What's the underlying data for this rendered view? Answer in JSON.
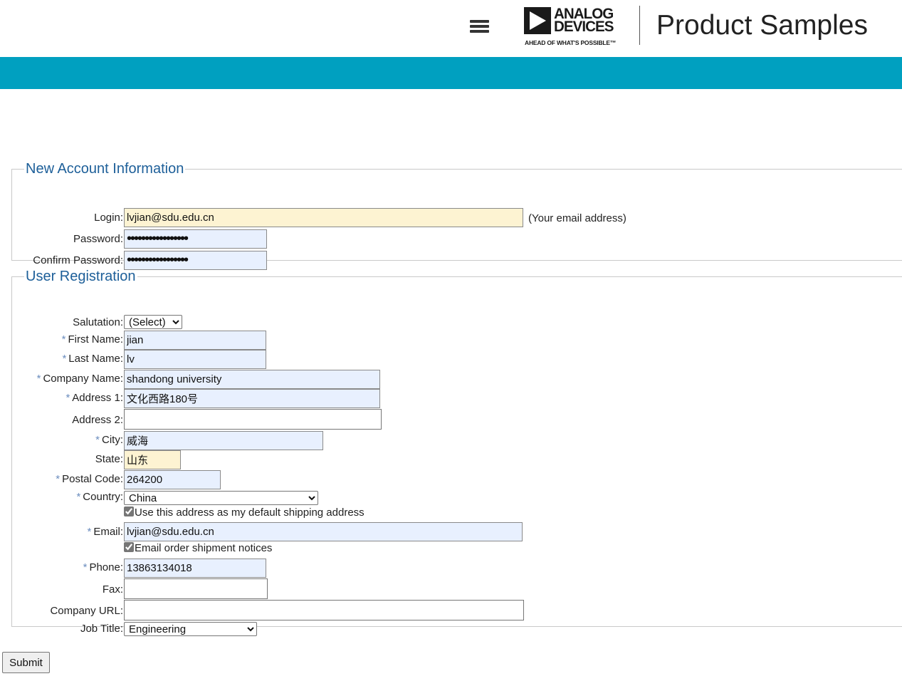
{
  "header": {
    "title": "Product Samples",
    "logo_line1": "ANALOG",
    "logo_line2": "DEVICES",
    "logo_tagline": "AHEAD OF WHAT'S POSSIBLE™"
  },
  "colors": {
    "accent_bar": "#00a0c0",
    "legend_text": "#1d5f99",
    "autofill_blue": "#e8f0fe",
    "autofill_yellow": "#fdf3d2"
  },
  "account": {
    "legend": "New Account Information",
    "login_label": "Login:",
    "login_value": "lvjian@sdu.edu.cn",
    "login_hint": "(Your email address)",
    "password_label": "Password:",
    "password_value": "lvjian@sdu.edu.cn",
    "confirm_label": "Confirm Password:",
    "confirm_value": "lvjian@sdu.edu.cn"
  },
  "registration": {
    "legend": "User Registration",
    "salutation_label": "Salutation:",
    "salutation_value": "(Select)",
    "first_name_label": "First Name:",
    "first_name_value": "jian",
    "last_name_label": "Last Name:",
    "last_name_value": "lv",
    "company_label": "Company Name:",
    "company_value": "shandong university",
    "address1_label": "Address 1:",
    "address1_value": "文化西路180号",
    "address2_label": "Address 2:",
    "address2_value": "",
    "city_label": "City:",
    "city_value": "威海",
    "state_label": "State:",
    "state_value": "山东",
    "postal_label": "Postal Code:",
    "postal_value": "264200",
    "country_label": "Country:",
    "country_value": "China",
    "default_shipping_label": "Use this address as my default shipping address",
    "email_label": "Email:",
    "email_value": "lvjian@sdu.edu.cn",
    "email_notices_label": "Email order shipment notices",
    "phone_label": "Phone:",
    "phone_value": "13863134018",
    "fax_label": "Fax:",
    "fax_value": "",
    "url_label": "Company URL:",
    "url_value": "",
    "job_title_label": "Job Title:",
    "job_title_value": "Engineering",
    "required_marker": "*"
  },
  "submit_label": "Submit"
}
